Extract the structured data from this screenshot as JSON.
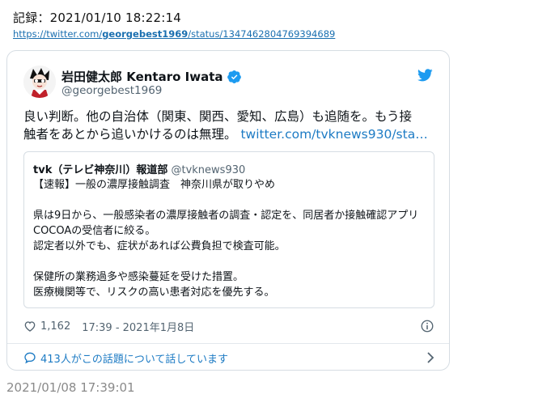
{
  "header": {
    "record_text": "記録：2021/01/10 18:22:14",
    "url_prefix": "https://twitter.com/",
    "url_user": "georgebest1969",
    "url_suffix": "/status/1347462804769394689"
  },
  "tweet": {
    "author_name": "岩田健太郎 Kentaro Iwata",
    "author_handle": "@georgebest1969",
    "text_line1": "良い判断。他の自治体（関東、関西、愛知、広島）も追随を。もう接",
    "text_line2": "触者をあとから追いかけるのは無理。",
    "link_text": "twitter.com/tvknews930/sta…",
    "quote": {
      "name": "tvk（テレビ神奈川）報道部",
      "handle": "@tvknews930",
      "line1": "【速報】一般の濃厚接触調査　神奈川県が取りやめ",
      "line2": "県は9日から、一般感染者の濃厚接触者の調査・認定を、同居者か接触確認アプリCOCOAの受信者に絞る。",
      "line3": "認定者以外でも、症状があれば公費負担で検査可能。",
      "line4": "保健所の業務過多や感染蔓延を受けた措置。",
      "line5": "医療機関等で、リスクの高い患者対応を優先する。"
    },
    "likes": "1,162",
    "timestamp": "17:39 - 2021年1月8日",
    "talk_text": "413人がこの話題について話しています"
  },
  "footer": {
    "date": "2021/01/08 17:39:01"
  },
  "colors": {
    "link": "#1d7bc4",
    "verified": "#1d9bf0",
    "muted": "#536471"
  },
  "icons": [
    "verified-badge-icon",
    "twitter-bird-icon",
    "heart-icon",
    "info-icon",
    "speech-bubble-icon",
    "chevron-right-icon"
  ]
}
